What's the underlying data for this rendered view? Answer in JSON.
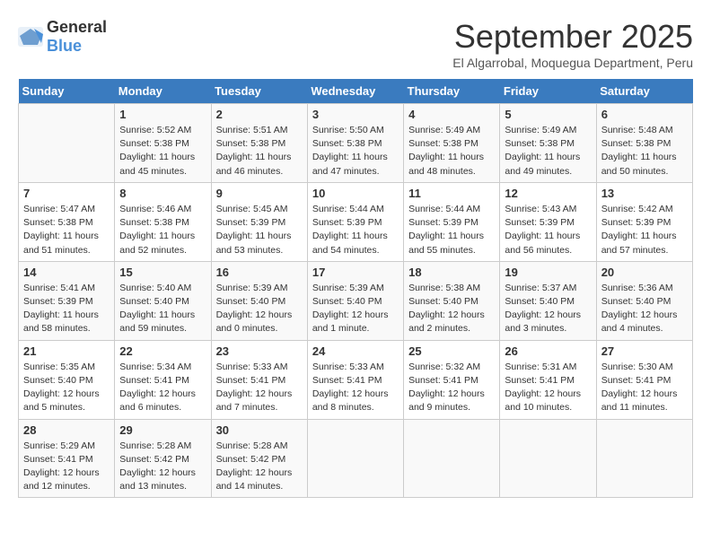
{
  "logo": {
    "text_general": "General",
    "text_blue": "Blue"
  },
  "title": "September 2025",
  "location": "El Algarrobal, Moquegua Department, Peru",
  "headers": [
    "Sunday",
    "Monday",
    "Tuesday",
    "Wednesday",
    "Thursday",
    "Friday",
    "Saturday"
  ],
  "weeks": [
    [
      {
        "day": "",
        "info": ""
      },
      {
        "day": "1",
        "info": "Sunrise: 5:52 AM\nSunset: 5:38 PM\nDaylight: 11 hours\nand 45 minutes."
      },
      {
        "day": "2",
        "info": "Sunrise: 5:51 AM\nSunset: 5:38 PM\nDaylight: 11 hours\nand 46 minutes."
      },
      {
        "day": "3",
        "info": "Sunrise: 5:50 AM\nSunset: 5:38 PM\nDaylight: 11 hours\nand 47 minutes."
      },
      {
        "day": "4",
        "info": "Sunrise: 5:49 AM\nSunset: 5:38 PM\nDaylight: 11 hours\nand 48 minutes."
      },
      {
        "day": "5",
        "info": "Sunrise: 5:49 AM\nSunset: 5:38 PM\nDaylight: 11 hours\nand 49 minutes."
      },
      {
        "day": "6",
        "info": "Sunrise: 5:48 AM\nSunset: 5:38 PM\nDaylight: 11 hours\nand 50 minutes."
      }
    ],
    [
      {
        "day": "7",
        "info": "Sunrise: 5:47 AM\nSunset: 5:38 PM\nDaylight: 11 hours\nand 51 minutes."
      },
      {
        "day": "8",
        "info": "Sunrise: 5:46 AM\nSunset: 5:38 PM\nDaylight: 11 hours\nand 52 minutes."
      },
      {
        "day": "9",
        "info": "Sunrise: 5:45 AM\nSunset: 5:39 PM\nDaylight: 11 hours\nand 53 minutes."
      },
      {
        "day": "10",
        "info": "Sunrise: 5:44 AM\nSunset: 5:39 PM\nDaylight: 11 hours\nand 54 minutes."
      },
      {
        "day": "11",
        "info": "Sunrise: 5:44 AM\nSunset: 5:39 PM\nDaylight: 11 hours\nand 55 minutes."
      },
      {
        "day": "12",
        "info": "Sunrise: 5:43 AM\nSunset: 5:39 PM\nDaylight: 11 hours\nand 56 minutes."
      },
      {
        "day": "13",
        "info": "Sunrise: 5:42 AM\nSunset: 5:39 PM\nDaylight: 11 hours\nand 57 minutes."
      }
    ],
    [
      {
        "day": "14",
        "info": "Sunrise: 5:41 AM\nSunset: 5:39 PM\nDaylight: 11 hours\nand 58 minutes."
      },
      {
        "day": "15",
        "info": "Sunrise: 5:40 AM\nSunset: 5:40 PM\nDaylight: 11 hours\nand 59 minutes."
      },
      {
        "day": "16",
        "info": "Sunrise: 5:39 AM\nSunset: 5:40 PM\nDaylight: 12 hours\nand 0 minutes."
      },
      {
        "day": "17",
        "info": "Sunrise: 5:39 AM\nSunset: 5:40 PM\nDaylight: 12 hours\nand 1 minute."
      },
      {
        "day": "18",
        "info": "Sunrise: 5:38 AM\nSunset: 5:40 PM\nDaylight: 12 hours\nand 2 minutes."
      },
      {
        "day": "19",
        "info": "Sunrise: 5:37 AM\nSunset: 5:40 PM\nDaylight: 12 hours\nand 3 minutes."
      },
      {
        "day": "20",
        "info": "Sunrise: 5:36 AM\nSunset: 5:40 PM\nDaylight: 12 hours\nand 4 minutes."
      }
    ],
    [
      {
        "day": "21",
        "info": "Sunrise: 5:35 AM\nSunset: 5:40 PM\nDaylight: 12 hours\nand 5 minutes."
      },
      {
        "day": "22",
        "info": "Sunrise: 5:34 AM\nSunset: 5:41 PM\nDaylight: 12 hours\nand 6 minutes."
      },
      {
        "day": "23",
        "info": "Sunrise: 5:33 AM\nSunset: 5:41 PM\nDaylight: 12 hours\nand 7 minutes."
      },
      {
        "day": "24",
        "info": "Sunrise: 5:33 AM\nSunset: 5:41 PM\nDaylight: 12 hours\nand 8 minutes."
      },
      {
        "day": "25",
        "info": "Sunrise: 5:32 AM\nSunset: 5:41 PM\nDaylight: 12 hours\nand 9 minutes."
      },
      {
        "day": "26",
        "info": "Sunrise: 5:31 AM\nSunset: 5:41 PM\nDaylight: 12 hours\nand 10 minutes."
      },
      {
        "day": "27",
        "info": "Sunrise: 5:30 AM\nSunset: 5:41 PM\nDaylight: 12 hours\nand 11 minutes."
      }
    ],
    [
      {
        "day": "28",
        "info": "Sunrise: 5:29 AM\nSunset: 5:41 PM\nDaylight: 12 hours\nand 12 minutes."
      },
      {
        "day": "29",
        "info": "Sunrise: 5:28 AM\nSunset: 5:42 PM\nDaylight: 12 hours\nand 13 minutes."
      },
      {
        "day": "30",
        "info": "Sunrise: 5:28 AM\nSunset: 5:42 PM\nDaylight: 12 hours\nand 14 minutes."
      },
      {
        "day": "",
        "info": ""
      },
      {
        "day": "",
        "info": ""
      },
      {
        "day": "",
        "info": ""
      },
      {
        "day": "",
        "info": ""
      }
    ]
  ]
}
